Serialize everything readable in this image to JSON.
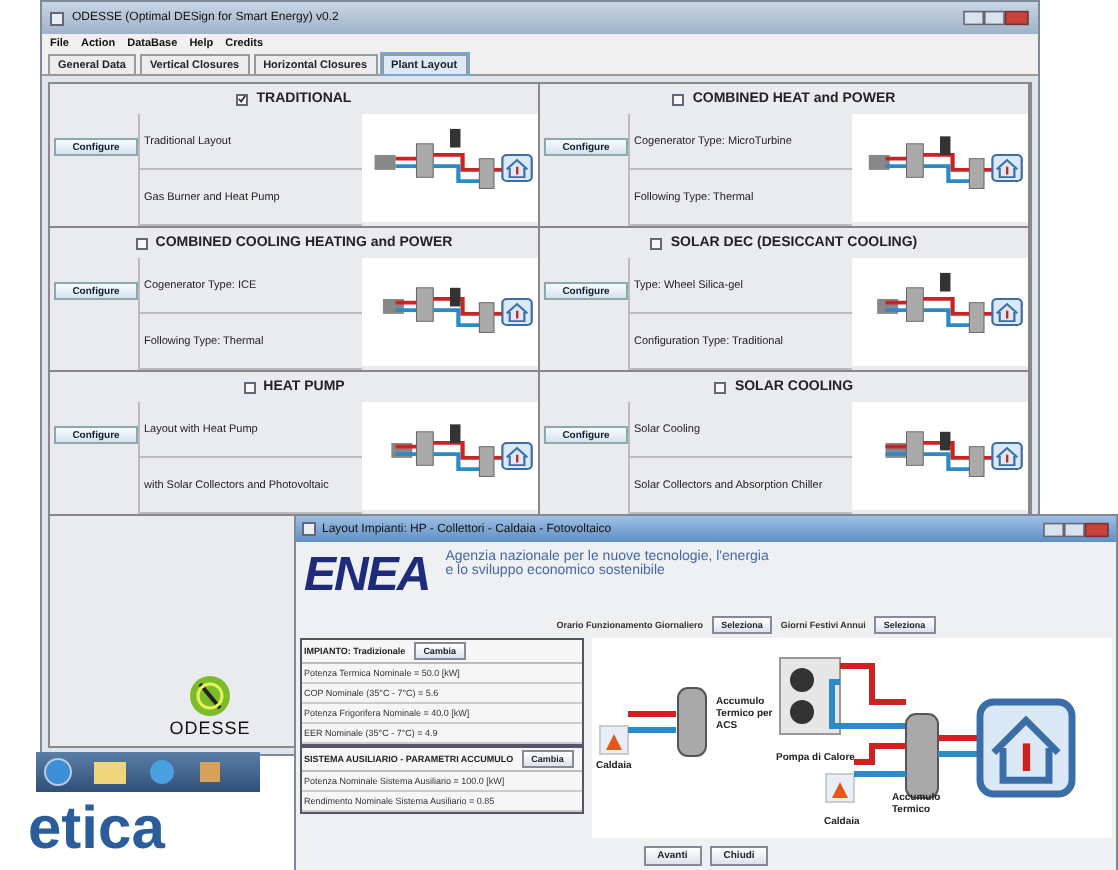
{
  "main_window": {
    "title": "ODESSE (Optimal DESign for Smart Energy) v0.2",
    "menu": [
      "File",
      "Action",
      "DataBase",
      "Help",
      "Credits"
    ],
    "tabs": [
      {
        "label": "General Data",
        "selected": false
      },
      {
        "label": "Vertical Closures",
        "selected": false
      },
      {
        "label": "Horizontal Closures",
        "selected": false
      },
      {
        "label": "Plant Layout",
        "selected": true
      }
    ],
    "layouts": [
      {
        "title": "TRADITIONAL",
        "checked": true,
        "button": "Configure",
        "lines": [
          "Traditional Layout",
          "Gas Burner and Heat Pump"
        ]
      },
      {
        "title": "COMBINED HEAT and POWER",
        "checked": false,
        "button": "Configure",
        "lines": [
          "Cogenerator Type: MicroTurbine",
          "Following Type: Thermal"
        ]
      },
      {
        "title": "COMBINED COOLING HEATING and POWER",
        "checked": false,
        "button": "Configure",
        "lines": [
          "Cogenerator Type: ICE",
          "Following Type: Thermal"
        ]
      },
      {
        "title": "SOLAR DEC (DESICCANT COOLING)",
        "checked": false,
        "button": "Configure",
        "lines": [
          "Type: Wheel Silica-gel",
          "Configuration Type: Traditional"
        ]
      },
      {
        "title": "HEAT PUMP",
        "checked": false,
        "button": "Configure",
        "lines": [
          "Layout with Heat Pump",
          "with Solar Collectors and Photovoltaic"
        ]
      },
      {
        "title": "SOLAR COOLING",
        "checked": false,
        "button": "Configure",
        "lines": [
          "Solar Cooling",
          "Solar Collectors and Absorption Chiller"
        ]
      }
    ],
    "logo_text": "ODESSE"
  },
  "layout_window": {
    "title": "Layout Impianti: HP - Collettori - Caldaia - Fotovoltaico",
    "logo_text": "ENEA",
    "agency_lines": [
      "Agenzia nazionale per le nuove tecnologie, l'energia",
      "e lo sviluppo economico sostenibile"
    ],
    "schedule": [
      {
        "label": "Orario Funzionamento Giornaliero",
        "button": "Seleziona"
      },
      {
        "label": "Giorni Festivi Annui",
        "button": "Seleziona"
      }
    ],
    "groups": [
      {
        "title": "IMPIANTO: Tradizionale",
        "button": "Cambia",
        "rows": [
          "Potenza Termica Nominale = 50.0 [kW]",
          "COP Nominale (35°C - 7°C) = 5.6",
          "Potenza Frigorifera Nominale = 40.0 [kW]",
          "EER Nominale (35°C - 7°C) = 4.9"
        ]
      },
      {
        "title": "SISTEMA AUSILIARIO - PARAMETRI ACCUMULO",
        "button": "Cambia",
        "rows": [
          "Potenza Nominale Sistema Ausiliario = 100.0 [kW]",
          "Rendimento Nominale Sistema Ausiliario = 0.85"
        ]
      }
    ],
    "diagram_labels": [
      "Caldaia",
      "Accumulo Termico per ACS",
      "Pompa di Calore",
      "Accumulo Termico",
      "Caldaia"
    ],
    "buttons": [
      "Avanti",
      "Chiudi"
    ]
  },
  "caption": "etica"
}
